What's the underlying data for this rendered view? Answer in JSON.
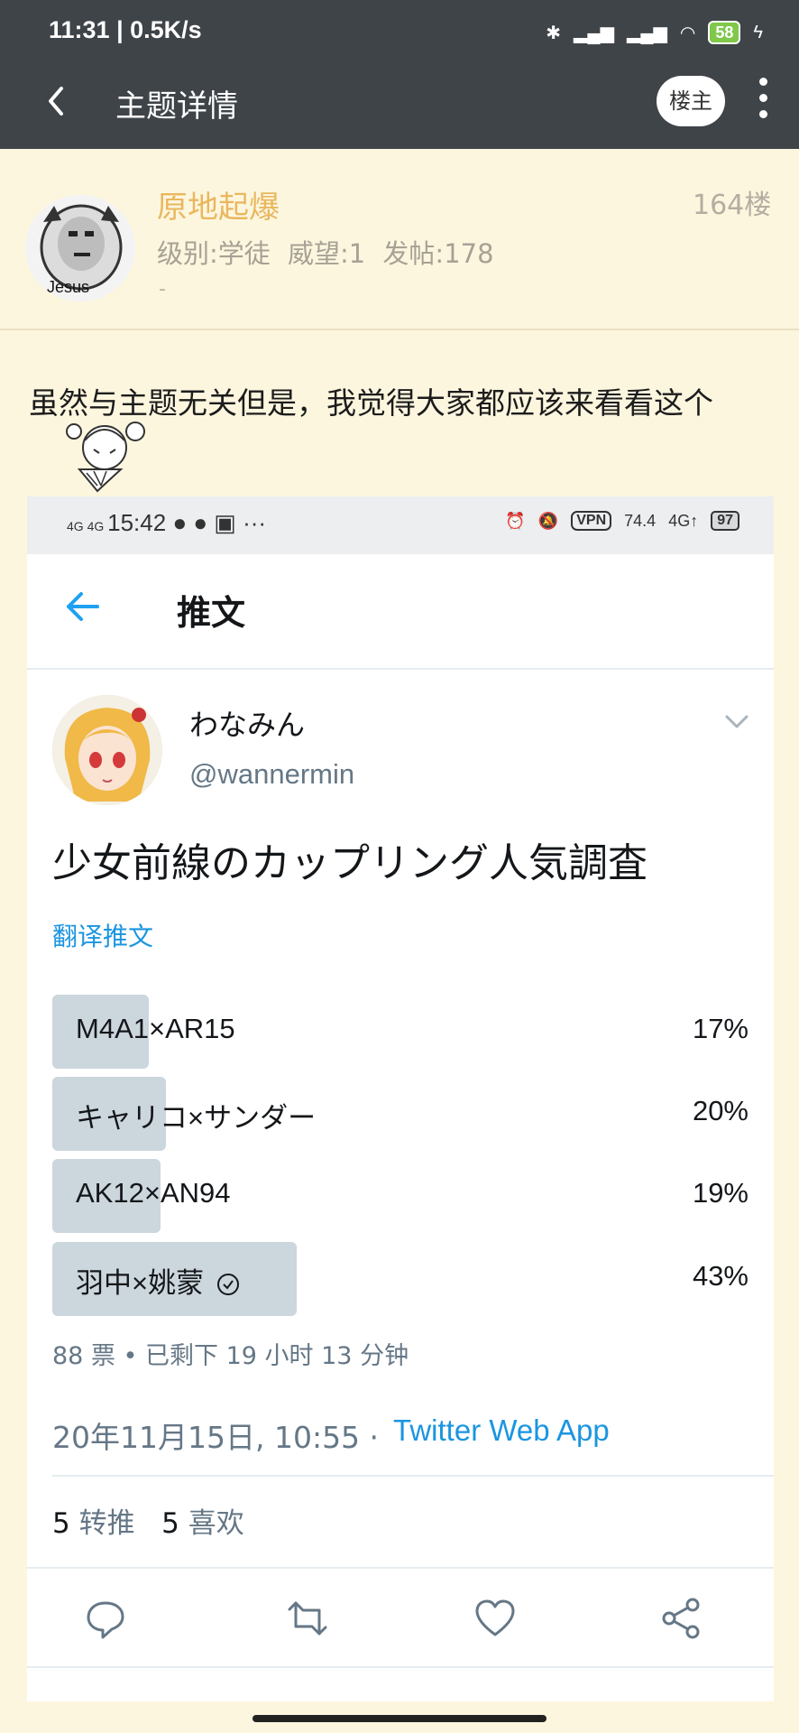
{
  "status_bar": {
    "time_speed": "11:31 | 0.5K/s",
    "battery": "58"
  },
  "toolbar": {
    "title": "主题详情",
    "op_label": "楼主"
  },
  "post": {
    "username": "原地起爆",
    "floor": "164楼",
    "stats": "级别:学徒 威望:1 发帖:178",
    "signature": "-",
    "avatar_caption": "Jesus",
    "text": "虽然与主题无关但是，我觉得大家都应该来看看这个"
  },
  "screenshot": {
    "status_time": "15:42",
    "status_speed": "74.4",
    "status_battery": "97",
    "vpn": "VPN",
    "header_title": "推文",
    "author_name": "わなみん",
    "author_handle": "@wannermin",
    "tweet_text": "少女前線のカップリング人気調査",
    "translate_label": "翻译推文",
    "poll": [
      {
        "label": "M4A1×AR15",
        "percent": "17%",
        "value": 17,
        "winner": false
      },
      {
        "label": "キャリコ×サンダー",
        "percent": "20%",
        "value": 20,
        "winner": false
      },
      {
        "label": "AK12×AN94",
        "percent": "19%",
        "value": 19,
        "winner": false
      },
      {
        "label": "羽中×姚蒙",
        "percent": "43%",
        "value": 43,
        "winner": true
      }
    ],
    "poll_meta": "88 票 • 已剩下 19 小时 13 分钟",
    "timestamp": "20年11月15日, 10:55 ·",
    "source": "Twitter Web App",
    "retweets": "5",
    "retweets_label": "转推",
    "likes": "5",
    "likes_label": "喜欢"
  },
  "colors": {
    "toolbar_bg": "#3f4449",
    "page_bg": "#fdf6df",
    "username": "#e9b75e",
    "link_blue": "#1b95e0",
    "poll_fill": "#ccd6dd"
  }
}
